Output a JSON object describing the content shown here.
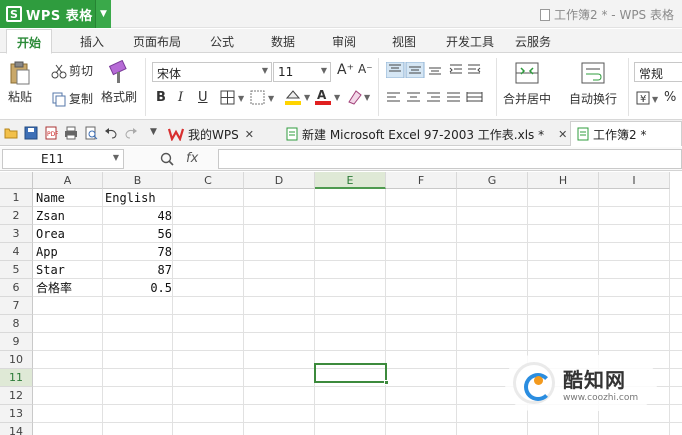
{
  "app": {
    "name": "WPS 表格",
    "window_title": "工作簿2 * - WPS 表格"
  },
  "menu": {
    "tabs": [
      "开始",
      "插入",
      "页面布局",
      "公式",
      "数据",
      "审阅",
      "视图",
      "开发工具",
      "云服务"
    ],
    "active": "开始"
  },
  "ribbon": {
    "paste": "粘贴",
    "cut": "剪切",
    "copy": "复制",
    "format_painter": "格式刷",
    "font_name": "宋体",
    "font_size": "11",
    "bold": "B",
    "italic": "I",
    "underline": "U",
    "merge_center": "合并居中",
    "wrap_text": "自动换行",
    "number_format": "常规",
    "percent": "%",
    "grow": "A⁺",
    "shrink": "A⁻"
  },
  "doc_tabs": [
    {
      "label": "我的WPS",
      "active": false
    },
    {
      "label": "新建 Microsoft Excel 97-2003 工作表.xls *",
      "active": false
    },
    {
      "label": "工作簿2 *",
      "active": true
    }
  ],
  "formula_bar": {
    "name_box": "E11",
    "fx": "fx",
    "value": ""
  },
  "sheet": {
    "columns": [
      "A",
      "B",
      "C",
      "D",
      "E",
      "F",
      "G",
      "H",
      "I"
    ],
    "rows": [
      "1",
      "2",
      "3",
      "4",
      "5",
      "6",
      "7",
      "8",
      "9",
      "10",
      "11",
      "12",
      "13",
      "14"
    ],
    "active_cell": "E11",
    "cells": {
      "a1": "Name",
      "b1": "English",
      "a2": "Zsan",
      "b2": "48",
      "a3": "Orea",
      "b3": "56",
      "a4": "App",
      "b4": "78",
      "a5": "Star",
      "b5": "87",
      "a6": "合格率",
      "b6": "0.5"
    }
  },
  "watermark": {
    "brand": "酷知网",
    "url": "www.coozhi.com"
  },
  "colors": {
    "accent_green": "#2f9c3e",
    "selection": "#3c8a3c"
  }
}
